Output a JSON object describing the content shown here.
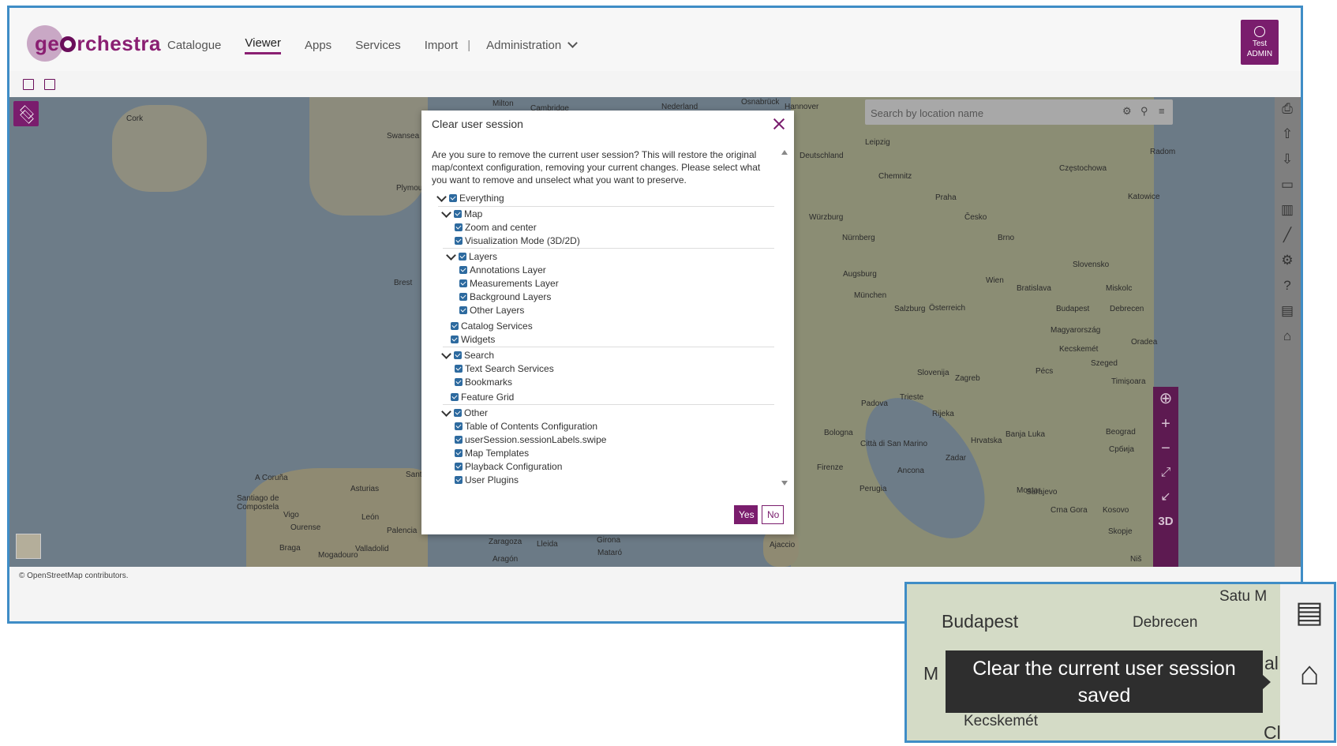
{
  "app": {
    "logo_text_1": "ge",
    "logo_text_2": "rchestra"
  },
  "nav": {
    "items": [
      "Catalogue",
      "Viewer",
      "Apps",
      "Services",
      "Import"
    ],
    "separator": "|",
    "admin_label": "Administration",
    "active": "Viewer"
  },
  "user": {
    "line1": "Test",
    "line2": "ADMIN"
  },
  "search": {
    "placeholder": "Search by location name"
  },
  "map": {
    "attribution": "© OpenStreetMap contributors.",
    "cities": [
      "Milton",
      "Cambridge",
      "Nederland",
      "Osnabrück",
      "Hannover",
      "Cork",
      "Swansea",
      "Plymouth",
      "Brest",
      "A Coruña",
      "Santiago de Compostela",
      "Vigo",
      "Ourense",
      "León",
      "Braga",
      "Palencia",
      "Valladolid",
      "Mogadouro",
      "Asturias",
      "Santa",
      "Zaragoza",
      "Lleida",
      "Girona",
      "Mataró",
      "Aragón",
      "Ajaccio",
      "Leipzig",
      "Deutschland",
      "Chemnitz",
      "Praha",
      "Česko",
      "Brno",
      "Würzburg",
      "Nürnberg",
      "Augsburg",
      "München",
      "Salzburg",
      "Österreich",
      "Wien",
      "Bratislava",
      "Budapest",
      "Magyarország",
      "Slovensko",
      "Katowice",
      "Częstochowa",
      "Radom",
      "Szeged",
      "Timișoara",
      "Zagreb",
      "Slovenija",
      "Hrvatska",
      "Beograd",
      "Србија",
      "Sarajevo",
      "Bologna",
      "Firenze",
      "Perugia",
      "Ancona",
      "Città di San Marino",
      "Rijeka",
      "Zadar",
      "Padova",
      "Trieste",
      "Pécs",
      "Kecskemét",
      "Debrecen",
      "Miskolc",
      "Oradea",
      "Banja Luka",
      "Mostar",
      "Crna Gora",
      "Kosovo",
      "Skopje",
      "Niš"
    ],
    "zoom_3d": "3D"
  },
  "dialog": {
    "title": "Clear user session",
    "message": "Are you sure to remove the current user session? This will restore the original map/context configuration, removing your current changes. Please select what you want to remove and unselect what you want to preserve.",
    "tree": [
      {
        "label": "Everything"
      },
      {
        "label": "Map"
      },
      {
        "label": "Zoom and center"
      },
      {
        "label": "Visualization Mode (3D/2D)"
      },
      {
        "label": "Layers"
      },
      {
        "label": "Annotations Layer"
      },
      {
        "label": "Measurements Layer"
      },
      {
        "label": "Background Layers"
      },
      {
        "label": "Other Layers"
      },
      {
        "label": "Catalog Services"
      },
      {
        "label": "Widgets"
      },
      {
        "label": "Search"
      },
      {
        "label": "Text Search Services"
      },
      {
        "label": "Bookmarks"
      },
      {
        "label": "Feature Grid"
      },
      {
        "label": "Other"
      },
      {
        "label": "Table of Contents Configuration"
      },
      {
        "label": "userSession.sessionLabels.swipe"
      },
      {
        "label": "Map Templates"
      },
      {
        "label": "Playback Configuration"
      },
      {
        "label": "User Plugins"
      }
    ],
    "yes_label": "Yes",
    "no_label": "No"
  },
  "inset": {
    "cities": [
      "Budapest",
      "Debrecen",
      "Satu M",
      "Kecskemét",
      "M",
      "al",
      "Cl"
    ],
    "tooltip": "Clear the current user session saved"
  },
  "colors": {
    "brand": "#7a1d6d",
    "frame_border": "#3f8dc6",
    "checkbox": "#2d6a9f"
  }
}
